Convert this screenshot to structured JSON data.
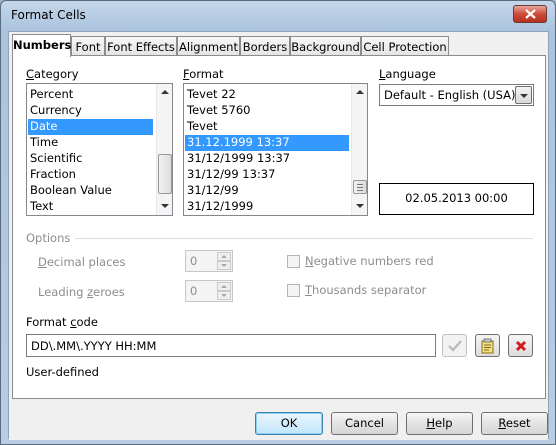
{
  "window": {
    "title": "Format Cells"
  },
  "tabs": [
    {
      "label": "Numbers",
      "active": true
    },
    {
      "label": "Font",
      "active": false
    },
    {
      "label": "Font Effects",
      "active": false
    },
    {
      "label": "Alignment",
      "active": false
    },
    {
      "label": "Borders",
      "active": false
    },
    {
      "label": "Background",
      "active": false
    },
    {
      "label": "Cell Protection",
      "active": false
    }
  ],
  "category": {
    "label_u": "C",
    "label_rest": "ategory",
    "items": [
      "Percent",
      "Currency",
      "Date",
      "Time",
      "Scientific",
      "Fraction",
      "Boolean Value",
      "Text"
    ],
    "selected": "Date"
  },
  "format": {
    "label_u": "F",
    "label_rest": "ormat",
    "items": [
      "Tevet 22",
      "Tevet 5760",
      "Tevet",
      "31.12.1999 13:37",
      "31/12/1999 13:37",
      "31/12/99 13:37",
      "31/12/99",
      "31/12/1999"
    ],
    "selected": "31.12.1999 13:37"
  },
  "language": {
    "label_u": "L",
    "label_rest": "anguage",
    "value": "Default - English (USA)"
  },
  "preview": {
    "text": "02.05.2013 00:00"
  },
  "options": {
    "heading": "Options",
    "decimal_places": {
      "label_u": "D",
      "label_rest": "ecimal places",
      "value": "0"
    },
    "leading_zeroes": {
      "label_pre": "Leading ",
      "label_u": "z",
      "label_rest": "eroes",
      "value": "0"
    },
    "negative_red": {
      "label_u": "N",
      "label_rest": "egative numbers red",
      "checked": false
    },
    "thousands_sep": {
      "label_u": "T",
      "label_rest": "housands separator",
      "checked": false
    }
  },
  "format_code": {
    "label_pre": "Format ",
    "label_u": "c",
    "label_rest": "ode",
    "value": "DD\\.MM\\.YYYY HH:MM",
    "description": "User-defined"
  },
  "buttons": {
    "ok": "OK",
    "cancel": "Cancel",
    "help_u": "H",
    "help_rest": "elp",
    "reset_u": "R",
    "reset_rest": "eset"
  },
  "icons": {
    "accept": "checkmark-icon",
    "comment": "edit-comment-icon",
    "delete": "delete-x-icon"
  }
}
